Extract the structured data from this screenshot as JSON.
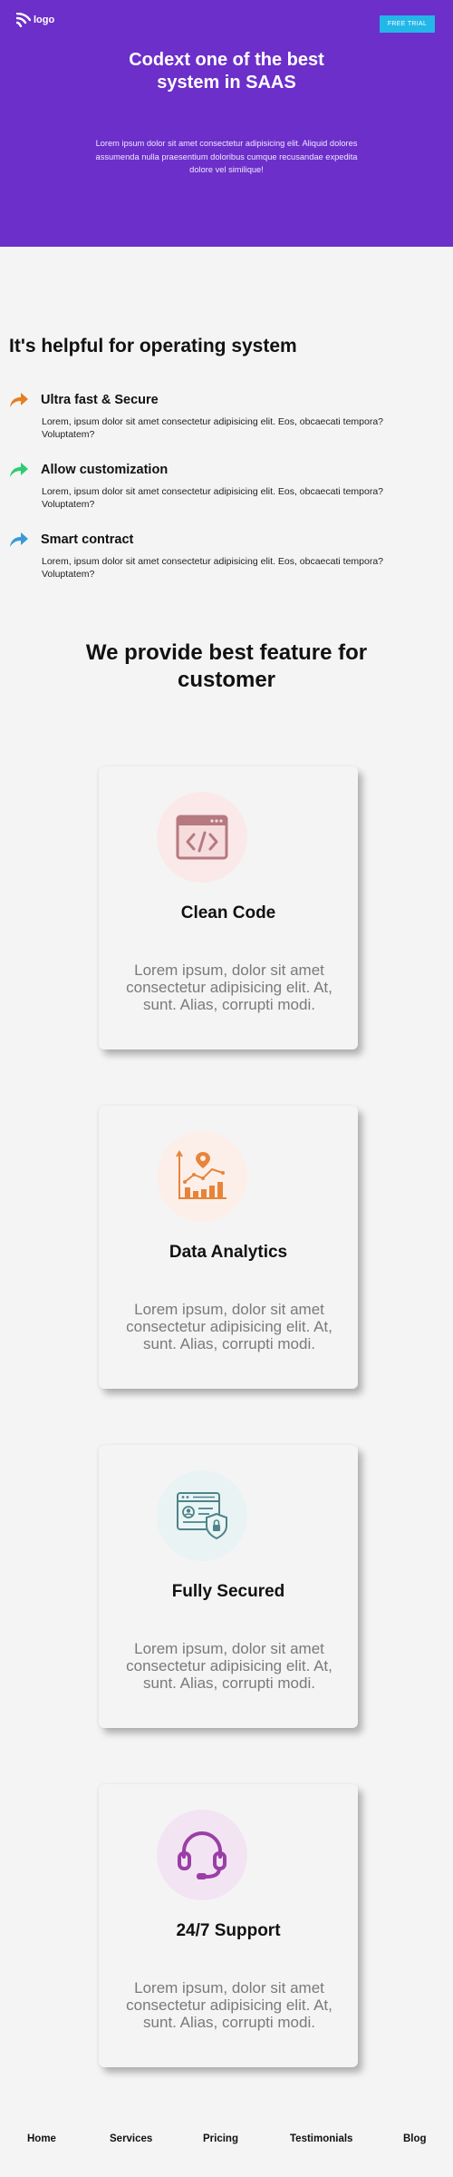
{
  "header": {
    "logo_text": "logo",
    "cta_label": "FREE TRIAL",
    "title": "Codext one of the best system in SAAS",
    "subtitle": "Lorem ipsum dolor sit amet consectetur adipisicing elit. Aliquid dolores assumenda nulla praesentium doloribus cumque recusandae expedita dolore vel similique!"
  },
  "helpful": {
    "title": "It's helpful for operating system",
    "items": [
      {
        "title": "Ultra fast & Secure",
        "text": "Lorem, ipsum dolor sit amet consectetur adipisicing elit. Eos, obcaecati tempora? Voluptatem?",
        "icon": "share-arrow-icon",
        "color": "#e67e22"
      },
      {
        "title": "Allow customization",
        "text": "Lorem, ipsum dolor sit amet consectetur adipisicing elit. Eos, obcaecati tempora? Voluptatem?",
        "icon": "share-arrow-icon",
        "color": "#2ecc71"
      },
      {
        "title": "Smart contract",
        "text": "Lorem, ipsum dolor sit amet consectetur adipisicing elit. Eos, obcaecati tempora? Voluptatem?",
        "icon": "share-arrow-icon",
        "color": "#3a9ad9"
      }
    ]
  },
  "features": {
    "title": "We provide best feature for customer",
    "cards": [
      {
        "title": "Clean Code",
        "text": "Lorem ipsum, dolor sit amet consectetur adipisicing elit. At, sunt. Alias, corrupti modi.",
        "icon": "code-window-icon",
        "circle_color": "#fbe9ea"
      },
      {
        "title": "Data Analytics",
        "text": "Lorem ipsum, dolor sit amet consectetur adipisicing elit. At, sunt. Alias, corrupti modi.",
        "icon": "analytics-chart-icon",
        "circle_color": "#fcefe9"
      },
      {
        "title": "Fully Secured",
        "text": "Lorem ipsum, dolor sit amet consectetur adipisicing elit. At, sunt. Alias, corrupti modi.",
        "icon": "secure-profile-icon",
        "circle_color": "#e9f3f4"
      },
      {
        "title": "24/7 Support",
        "text": "Lorem ipsum, dolor sit amet consectetur adipisicing elit. At, sunt. Alias, corrupti modi.",
        "icon": "headset-icon",
        "circle_color": "#f3e4f3"
      }
    ]
  },
  "footer": {
    "links": [
      "Home",
      "Services",
      "Pricing",
      "Testimonials",
      "Blog"
    ]
  },
  "colors": {
    "hero_bg": "#6c2fc9",
    "cta_bg": "#22b7e8",
    "page_bg": "#f4f4f4"
  }
}
